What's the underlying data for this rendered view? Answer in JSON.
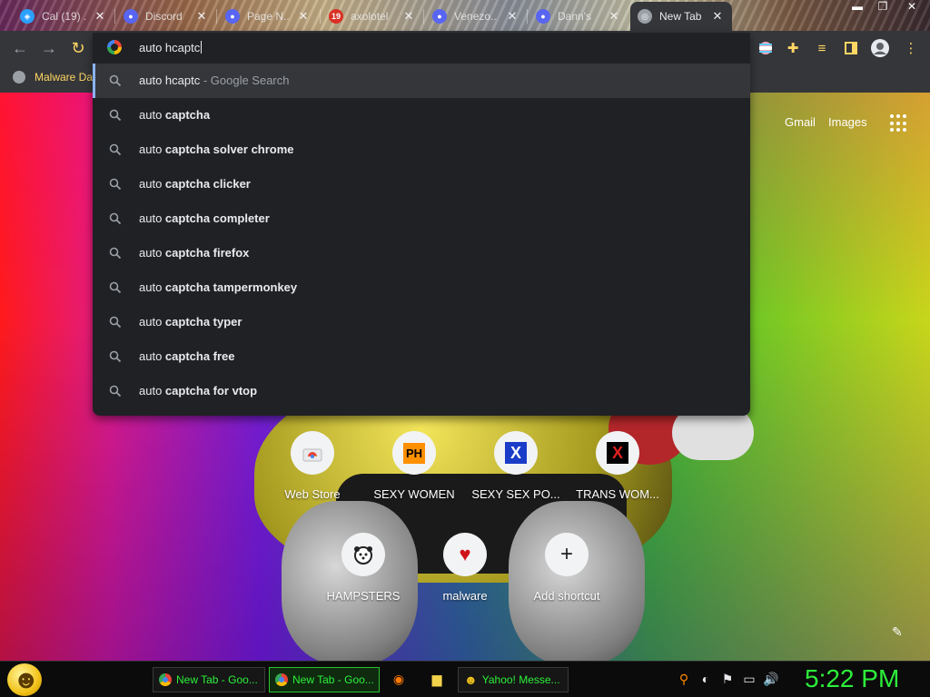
{
  "tabs": [
    {
      "label": "Cal (19) ...",
      "favicon": "shield-icon",
      "fav_color": "#2aa0ff"
    },
    {
      "label": "Discord",
      "favicon": "discord-icon",
      "fav_color": "#5865f2"
    },
    {
      "label": "Page N...",
      "favicon": "discord-icon",
      "fav_color": "#5865f2"
    },
    {
      "label": "axolotel",
      "favicon": "notification-badge",
      "fav_color": "#d93025",
      "badge": "19"
    },
    {
      "label": "Venezo...",
      "favicon": "discord-icon",
      "fav_color": "#5865f2"
    },
    {
      "label": "Dann's",
      "favicon": "discord-icon",
      "fav_color": "#5865f2"
    },
    {
      "label": "New Tab",
      "favicon": "chrome-icon",
      "fav_color": "#9aa0a6",
      "active": true
    }
  ],
  "tab_close_glyph": "✕",
  "omnibox": {
    "value": "auto hcaptc",
    "suggestions": [
      {
        "prefix": "auto hcaptc",
        "bold": "",
        "hint": " - Google Search",
        "selected": true
      },
      {
        "prefix": "auto ",
        "bold": "captcha",
        "hint": ""
      },
      {
        "prefix": "auto ",
        "bold": "captcha solver chrome",
        "hint": ""
      },
      {
        "prefix": "auto ",
        "bold": "captcha clicker",
        "hint": ""
      },
      {
        "prefix": "auto ",
        "bold": "captcha completer",
        "hint": ""
      },
      {
        "prefix": "auto ",
        "bold": "captcha firefox",
        "hint": ""
      },
      {
        "prefix": "auto ",
        "bold": "captcha tampermonkey",
        "hint": ""
      },
      {
        "prefix": "auto ",
        "bold": "captcha typer",
        "hint": ""
      },
      {
        "prefix": "auto ",
        "bold": "captcha free",
        "hint": ""
      },
      {
        "prefix": "auto ",
        "bold": "captcha for vtop",
        "hint": ""
      }
    ]
  },
  "bookmarks": [
    {
      "label": "Malware Da"
    }
  ],
  "ntp": {
    "gmail": "Gmail",
    "images": "Images",
    "shortcuts": [
      {
        "name": "Web Store",
        "icon": "web-store-icon",
        "glyph": "◓",
        "color": "#ea4335"
      },
      {
        "name": "SEXY WOMEN",
        "icon": "ph-logo-icon",
        "glyph": "PH",
        "color": "#000000",
        "bg": "#ff9000"
      },
      {
        "name": "SEXY SEX PO...",
        "icon": "x-logo-icon",
        "glyph": "X",
        "color": "#1a3cc8"
      },
      {
        "name": "TRANS WOM...",
        "icon": "x-logo-icon",
        "glyph": "X",
        "color": "#c81a1a"
      },
      {
        "name": "HAMPSTERS",
        "icon": "hamster-icon",
        "glyph": "❖",
        "color": "#222222"
      },
      {
        "name": "malware",
        "icon": "heart-icon",
        "glyph": "♥",
        "color": "#d0121b"
      },
      {
        "name": "Add shortcut",
        "icon": "plus-icon",
        "glyph": "+",
        "color": "#202124"
      }
    ]
  },
  "taskbar": {
    "buttons": [
      {
        "label": "New Tab - Goo...",
        "active": false
      },
      {
        "label": "New Tab - Goo...",
        "active": true
      },
      {
        "label": "Yahoo! Messe...",
        "active": false
      }
    ],
    "clock": "5:22 PM"
  },
  "colors": {
    "accent": "#8ab4f8",
    "taskbar_text": "#2cf03a",
    "bookmark_text": "#fdd663"
  }
}
